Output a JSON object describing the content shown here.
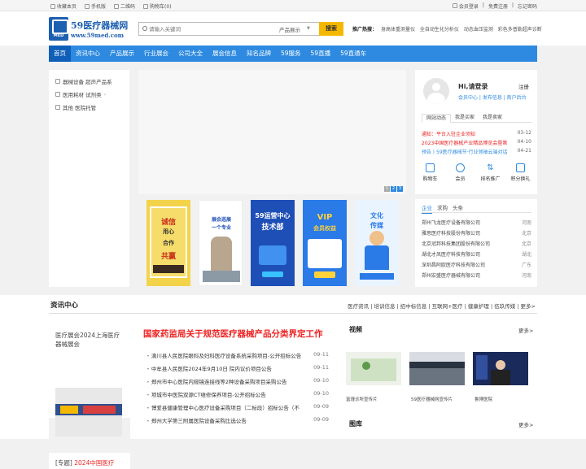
{
  "topbar": {
    "left": [
      "收藏本页",
      "手机版",
      "二维码",
      "购物车(0)"
    ],
    "right": [
      "会员登录",
      "免费注册",
      "忘记密码"
    ],
    "separator": "|"
  },
  "header": {
    "logo_name": "59医疗器械网",
    "logo_url": "www.59med.com",
    "logo_mark": "MED",
    "search_placeholder": "请输入关键词",
    "search_category": "产品展示",
    "search_button": "搜索",
    "hot_label": "推广热搜：",
    "hot_terms": [
      "身高体重测量仪",
      "全自动生化分析仪",
      "动态血压监测",
      "彩色多普勒超声诊断"
    ]
  },
  "nav": [
    "首页",
    "资讯中心",
    "产品展示",
    "行业展会",
    "公司大全",
    "展会信息",
    "知名品牌",
    "59服务",
    "59直播",
    "59直通车"
  ],
  "categories": [
    {
      "label": "器械设备 超声产品系"
    },
    {
      "label": "医用耗材 试剂类"
    },
    {
      "label": "其他 医院托管"
    }
  ],
  "banner": {
    "pages": [
      "1",
      "2",
      "3"
    ]
  },
  "posters": [
    {
      "line1": "诚信",
      "line2": "用心",
      "line3": "合作",
      "line4": "共赢",
      "bg": "#f3d34a"
    },
    {
      "line1": "展会巡展",
      "line2": "一个专业",
      "bg": "#ffffff"
    },
    {
      "line1": "59运营中心",
      "line2": "技术部",
      "bg": "#1e4fb6"
    },
    {
      "line1": "VIP",
      "line2": "会员权益",
      "bg": "#2a7ae8"
    },
    {
      "line1": "文化",
      "line2": "传媒",
      "bg": "#e9f4ff"
    }
  ],
  "user_panel": {
    "greeting": "Hi,请登录",
    "register": "注册",
    "links": "会员中心 | 发布信息 | 商户后台",
    "tabs": [
      "网站动态",
      "我是买家",
      "我是卖家"
    ],
    "news": [
      {
        "title": "通知：平台入驻企业须知",
        "date": "03-12"
      },
      {
        "title": "2023中国医疗器械产业精品博览会暨第",
        "date": "04-10"
      },
      {
        "title": "预告丨59医疗器械节·行业领袖云端对话",
        "date": "04-21"
      }
    ],
    "quick": [
      "购物车",
      "会员",
      "排名推广",
      "积分换礼"
    ]
  },
  "company_panel": {
    "tabs": [
      "企业",
      "求购",
      "头条"
    ],
    "rows": [
      {
        "name": "郑州飞龙医疗设备有限公司",
        "prov": "河南"
      },
      {
        "name": "雅思医疗科技股份有限公司",
        "prov": "北京"
      },
      {
        "name": "北京冠邦科技集团股份有限公司",
        "prov": "北京"
      },
      {
        "name": "湖北才凤医疗科技有限公司",
        "prov": "湖北"
      },
      {
        "name": "深圳昌阿欧医疗科技有限公司",
        "prov": "广东"
      },
      {
        "name": "郑州宏盛医疗器械有限公司",
        "prov": "河南"
      }
    ]
  },
  "news_section": {
    "title": "资讯中心",
    "tabs": [
      "医疗资讯",
      "培训信息",
      "招中标信息",
      "互联网+医疗",
      "健康护理",
      "伍玖传媒"
    ],
    "more": "更多>",
    "expo_title": "医疗展会2024上海医疗器械展会",
    "topic_prefix": "[专题]",
    "topic_title": "2024中国医疗",
    "headline": "国家药监局关于规范医疗器械产品分类界定工作",
    "articles": [
      {
        "title": "滴川县人民医院眼科及妇科医疗设备系统采购项目-公开招标公告",
        "date": "09-11"
      },
      {
        "title": "中牟县人民医院2024年9月10日 院内议价项目公告",
        "date": "09-11"
      },
      {
        "title": "郑州市中心医院内窥镜连接线等2种设备采购项目采购公告",
        "date": "09-10"
      },
      {
        "title": "项城市中医院双源CT维修保养项目-公开招标公告",
        "date": "09-10"
      },
      {
        "title": "博爱县健康管理中心医疗设备采购项目（二标段）招标公告（不",
        "date": "09-09"
      },
      {
        "title": "郑州大学第三附属医院设备采购比选公告",
        "date": "09-09"
      }
    ],
    "video_title": "视频",
    "videos": [
      "富瑾诊所宣传片",
      "59医疗器械网宣传片",
      "鲁博医院"
    ],
    "library_title": "图库"
  }
}
